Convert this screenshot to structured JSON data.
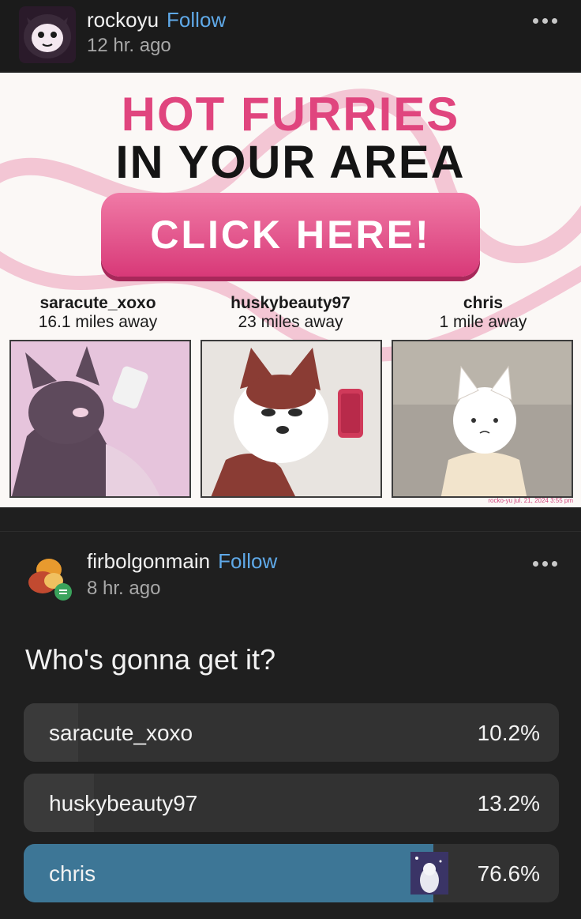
{
  "post1": {
    "username": "rockoyu",
    "follow_label": "Follow",
    "timestamp": "12 hr. ago"
  },
  "ad": {
    "title_line1": "HOT FURRIES",
    "title_line2": "IN YOUR AREA",
    "cta_label": "CLICK HERE!",
    "profiles": [
      {
        "name": "saracute_xoxo",
        "distance": "16.1 miles away"
      },
      {
        "name": "huskybeauty97",
        "distance": "23 miles away"
      },
      {
        "name": "chris",
        "distance": "1 mile away"
      }
    ],
    "watermark": "rocko-yu jul. 21, 2024 3:55 pm",
    "colors": {
      "pink": "#e0457e",
      "background": "#fbf8f6"
    }
  },
  "post2": {
    "username": "firbolgonmain",
    "follow_label": "Follow",
    "timestamp": "8 hr. ago"
  },
  "poll": {
    "question": "Who's gonna get it?",
    "options": [
      {
        "label": "saracute_xoxo",
        "percent": "10.2%",
        "fraction": 0.102
      },
      {
        "label": "huskybeauty97",
        "percent": "13.2%",
        "fraction": 0.132
      },
      {
        "label": "chris",
        "percent": "76.6%",
        "fraction": 0.766,
        "selected": true
      }
    ],
    "colors": {
      "selected_fill": "#3d7696",
      "follow": "#5fa9e8"
    }
  }
}
